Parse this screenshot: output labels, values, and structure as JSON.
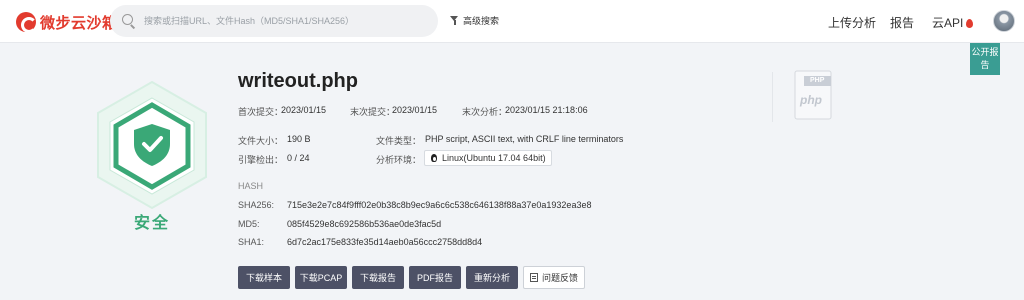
{
  "header": {
    "logo_text": "微步云沙箱",
    "search_placeholder": "搜索或扫描URL、文件Hash（MD5/SHA1/SHA256）",
    "advanced_search": "高级搜索",
    "nav": {
      "upload": "上传分析",
      "report": "报告",
      "api": "云API"
    },
    "public_report": "公开报告"
  },
  "result": {
    "label": "安全",
    "color": "#3aa877"
  },
  "file": {
    "name": "writeout.php",
    "first_submit_label": "首次提交：",
    "first_submit": "2023/01/15",
    "last_submit_label": "末次提交：",
    "last_submit": "2023/01/15",
    "last_analysis_label": "末次分析：",
    "last_analysis": "2023/01/15 21:18:06",
    "size_label": "文件大小：",
    "size": "190 B",
    "type_label": "文件类型：",
    "type": "PHP script, ASCII text, with CRLF line terminators",
    "engines_label": "引擎检出：",
    "engines": "0 / 24",
    "env_label": "分析环境：",
    "env": "Linux(Ubuntu 17.04 64bit)",
    "icon_badge": "PHP",
    "icon_text": "php"
  },
  "hash": {
    "heading": "HASH",
    "sha256_label": "SHA256:",
    "sha256": "715e3e2e7c84f9fff02e0b38c8b9ec9a6c6c538c646138f88a37e0a1932ea3e8",
    "md5_label": "MD5:",
    "md5": "085f4529e8c692586b536ae0de3fac5d",
    "sha1_label": "SHA1:",
    "sha1": "6d7c2ac175e833fe35d14aeb0a56ccc2758dd8d4"
  },
  "actions": {
    "download_sample": "下载样本",
    "download_pcap": "下载PCAP",
    "download_report": "下载报告",
    "pdf_report": "PDF报告",
    "reanalyze": "重新分析",
    "feedback": "问题反馈"
  }
}
